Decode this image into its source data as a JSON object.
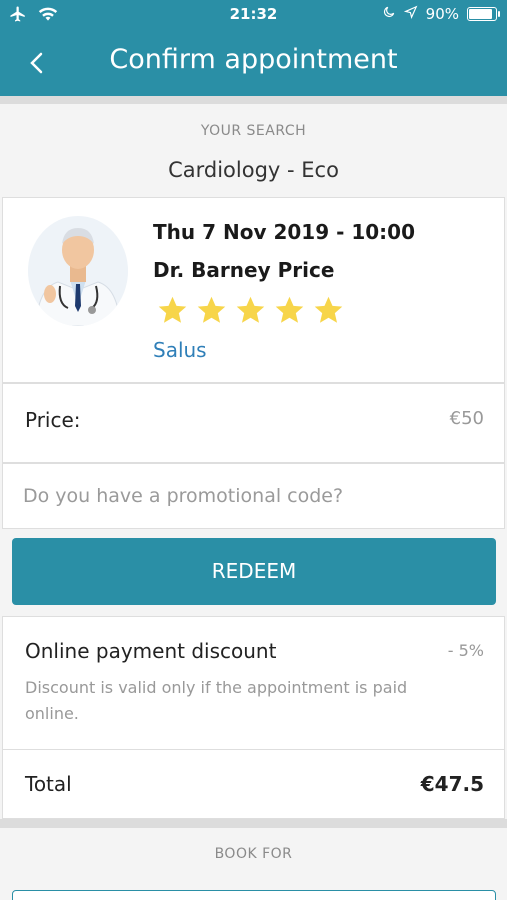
{
  "status_bar": {
    "time": "21:32",
    "battery_percent": "90%",
    "battery_level": 0.9,
    "icons": [
      "airplane-icon",
      "wifi-icon",
      "moon-icon",
      "location-arrow-icon",
      "battery-icon"
    ]
  },
  "header": {
    "title": "Confirm appointment",
    "back_icon": "chevron-left-icon"
  },
  "search": {
    "label": "YOUR SEARCH",
    "value": "Cardiology - Eco"
  },
  "appointment": {
    "datetime": "Thu 7 Nov 2019 - 10:00",
    "doctor_name": "Dr. Barney Price",
    "rating": 5,
    "rating_max": 5,
    "clinic": "Salus"
  },
  "price": {
    "label": "Price:",
    "value": "€50"
  },
  "promo": {
    "placeholder": "Do you have a promotional code?",
    "value": ""
  },
  "redeem_label": "REDEEM",
  "discount": {
    "label": "Online payment discount",
    "value": "- 5%",
    "note": "Discount is valid only if the appointment is paid online."
  },
  "total": {
    "label": "Total",
    "value": "€47.5"
  },
  "book_for": {
    "label": "BOOK FOR"
  },
  "colors": {
    "primary": "#2a8fa6",
    "link": "#2f7fb8",
    "star": "#f7d54a"
  }
}
